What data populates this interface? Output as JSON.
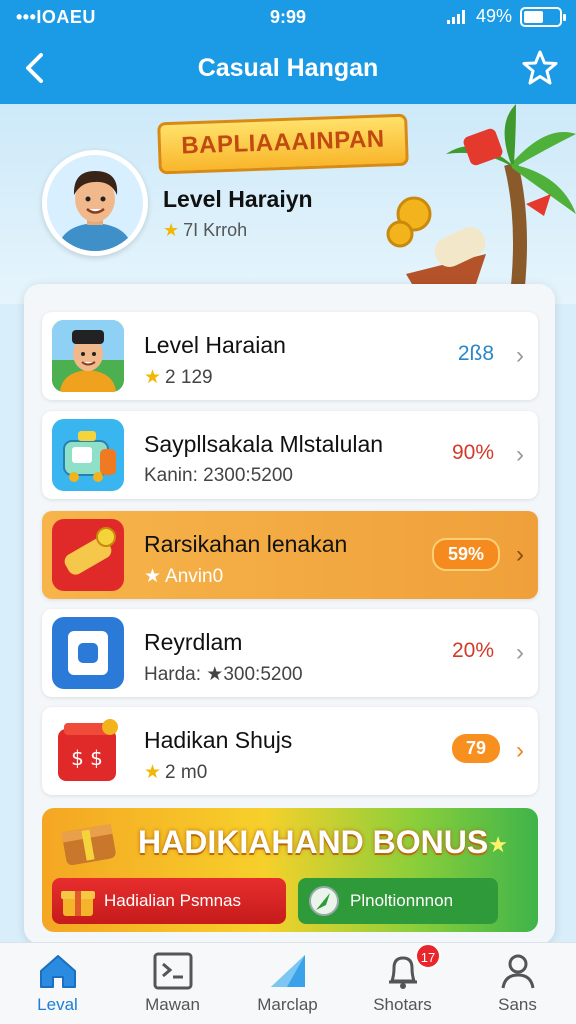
{
  "status": {
    "left": "•••IOAEU",
    "time": "9:99",
    "battery": "49%",
    "battery_level": 0.49
  },
  "header": {
    "title": "Casual Hangan"
  },
  "hero": {
    "banner": "BAPLIAAAINPAN",
    "title": "Level Haraiyn",
    "subtitle": "7I Krroh"
  },
  "items": [
    {
      "title": "Level Haraian",
      "subtitle": "2 129",
      "value": "2ß8",
      "value_color": "#2a88c8"
    },
    {
      "title": "Saypllsakala Mlstalulan",
      "subtitle": "Kanin: 2300:5200",
      "value": "90%",
      "value_color": "#d23a2a"
    },
    {
      "title": "Rarsikahan lenakan",
      "subtitle": "Anvin0",
      "value": "59%"
    },
    {
      "title": "Reyrdlam",
      "subtitle": "Harda: ★300:5200",
      "value": "20%",
      "value_color": "#d23a2a"
    },
    {
      "title": "Hadikan Shujs",
      "subtitle": "2 m0",
      "value": "79"
    }
  ],
  "bonus": {
    "title": "HADIKIAHAND BONUS",
    "button1": "Hadialian Psmnas",
    "button2": "Plnoltionnnon"
  },
  "tabs": [
    {
      "label": "Leval"
    },
    {
      "label": "Mawan"
    },
    {
      "label": "Marclap"
    },
    {
      "label": "Shotars",
      "badge": "17"
    },
    {
      "label": "Sans"
    }
  ],
  "colors": {
    "primary": "#1b9be6",
    "accent": "#f7901e",
    "active_tab": "#1b7fd6"
  }
}
